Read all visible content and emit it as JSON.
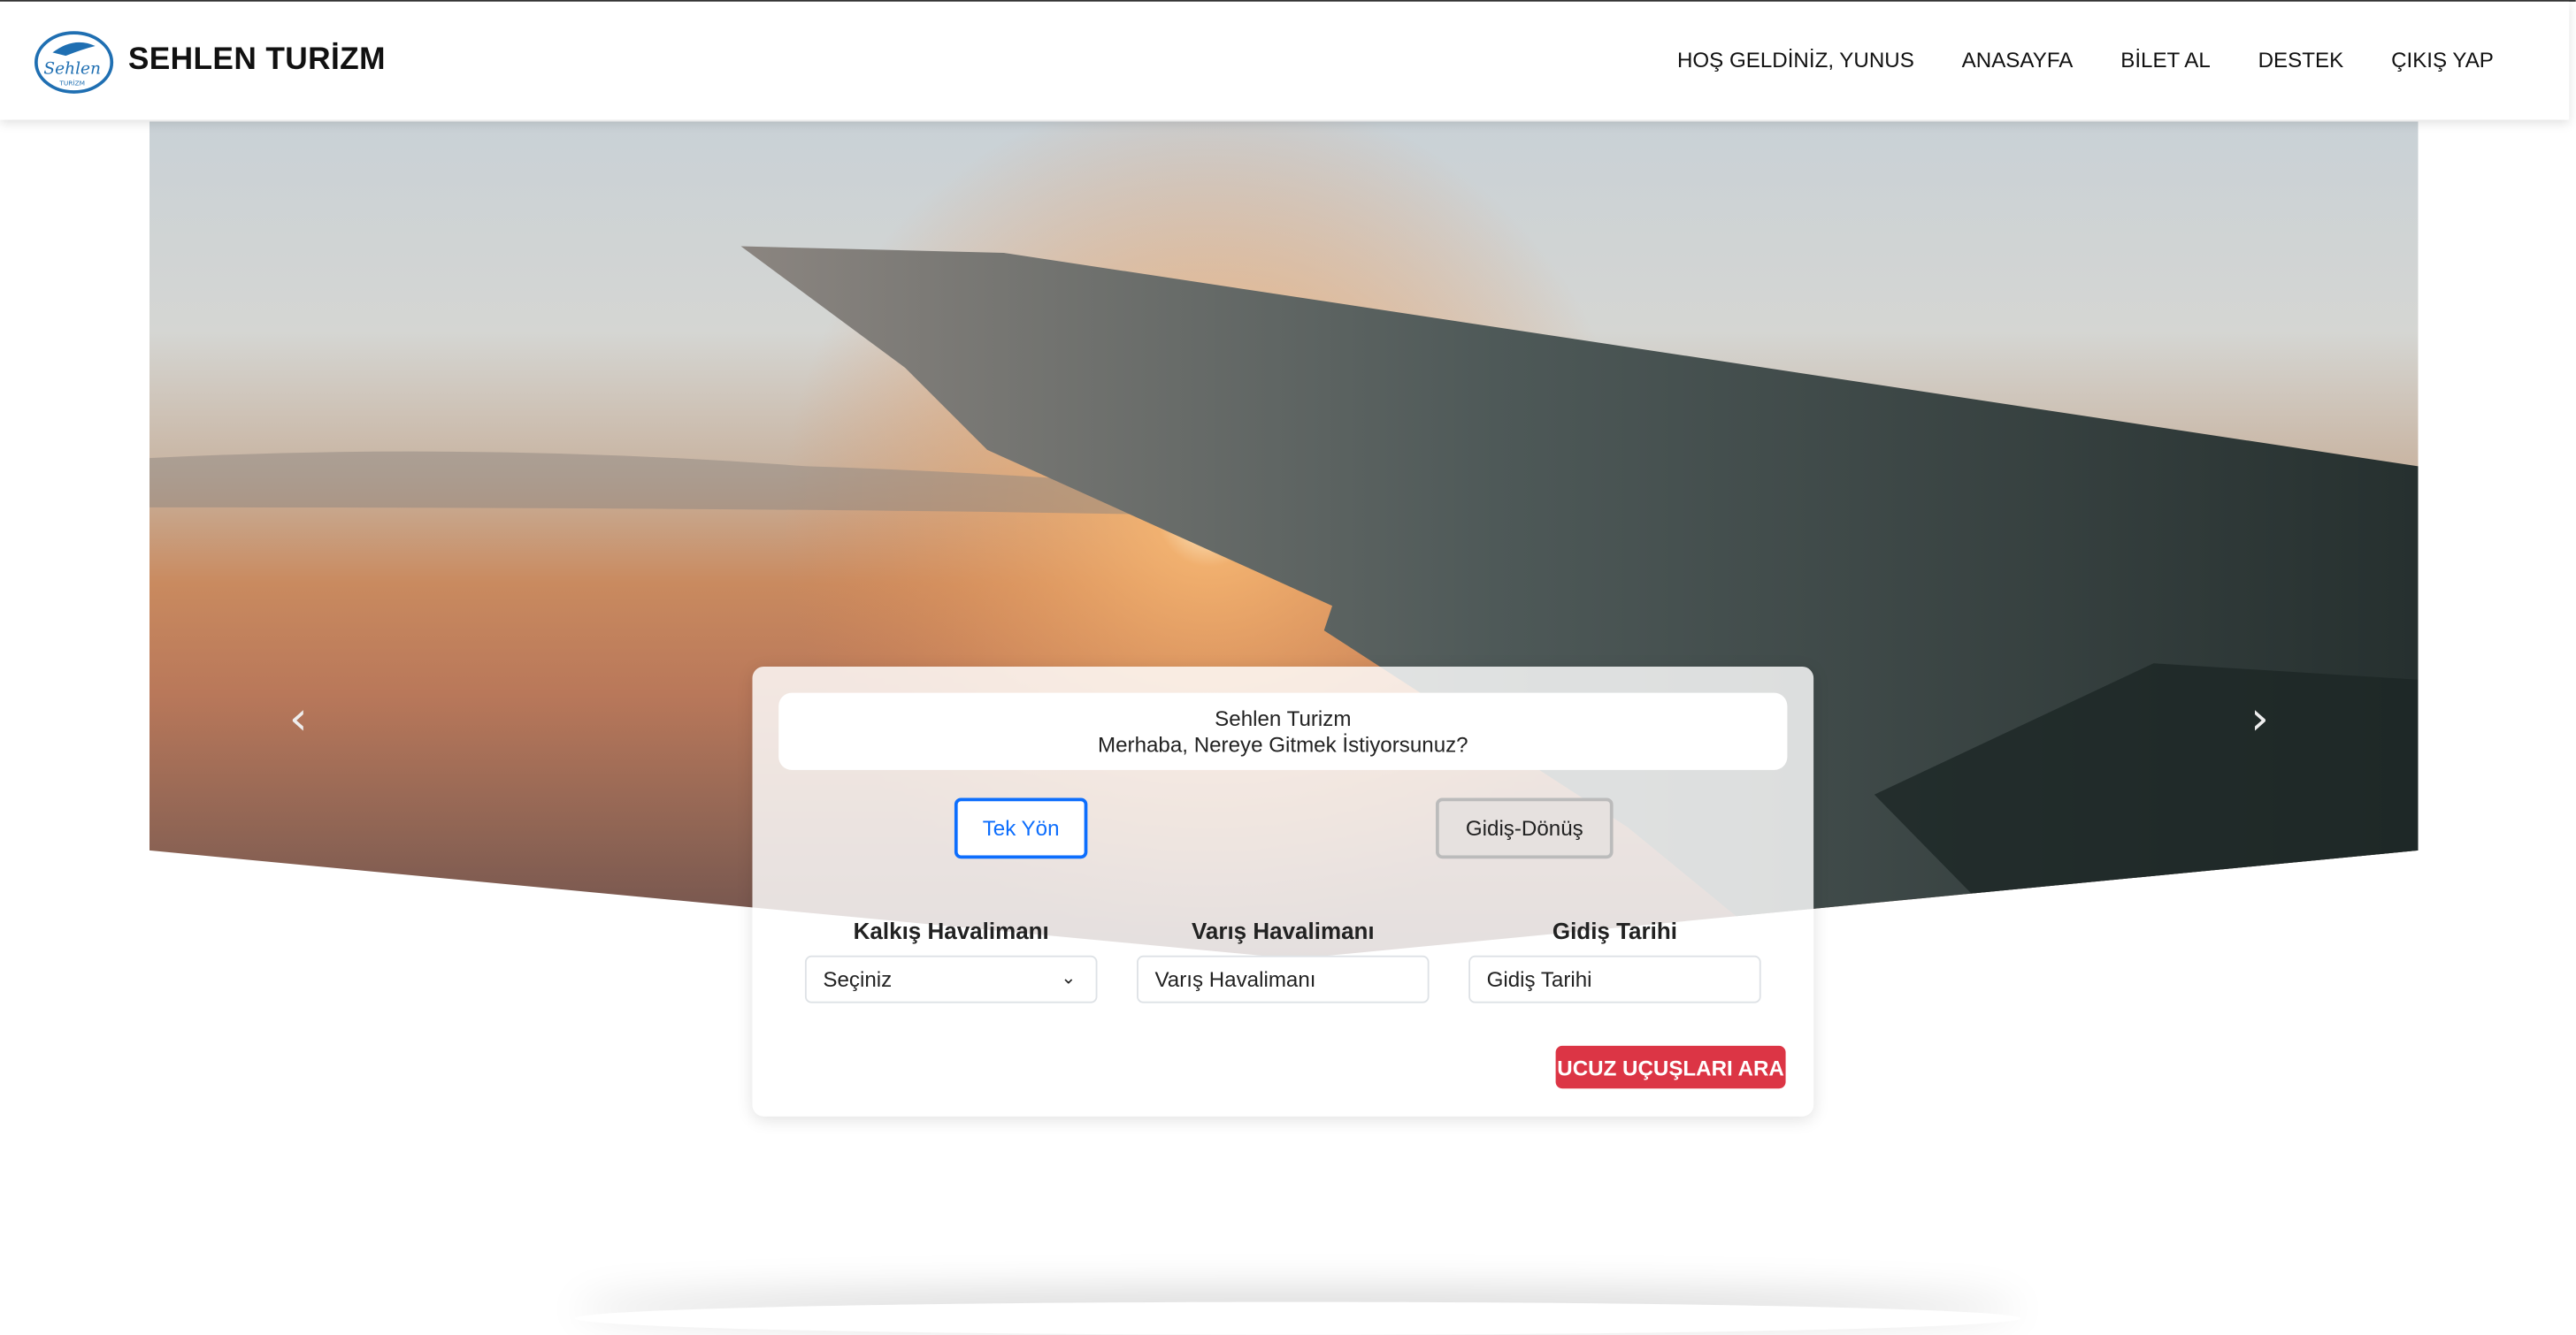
{
  "header": {
    "brand": "SEHLEN TURİZM",
    "logo_text": "Sehlen TURİZM",
    "nav": [
      "HOŞ GELDİNİZ, YUNUS",
      "ANASAYFA",
      "BİLET AL",
      "DESTEK",
      "ÇIKIŞ YAP"
    ]
  },
  "carousel": {
    "prev_icon": "chevron-left-icon",
    "next_icon": "chevron-right-icon",
    "prev": "‹",
    "next": "›"
  },
  "search_card": {
    "title": "Sehlen Turizm",
    "subtitle": "Merhaba, Nereye Gitmek İstiyorsunuz?",
    "trip_types": [
      "Tek Yön",
      "Gidiş-Dönüş"
    ],
    "departure": {
      "label": "Kalkış Havalimanı",
      "value": "Seçiniz"
    },
    "arrival": {
      "label": "Varış Havalimanı",
      "placeholder": "Varış Havalimanı"
    },
    "date": {
      "label": "Gidiş Tarihi",
      "placeholder": "Gidiş Tarihi"
    },
    "submit": "UCUZ UÇUŞLARI ARA"
  },
  "colors": {
    "primary": "#0d6efd",
    "danger": "#dc3545",
    "logo": "#1f6fb2"
  }
}
